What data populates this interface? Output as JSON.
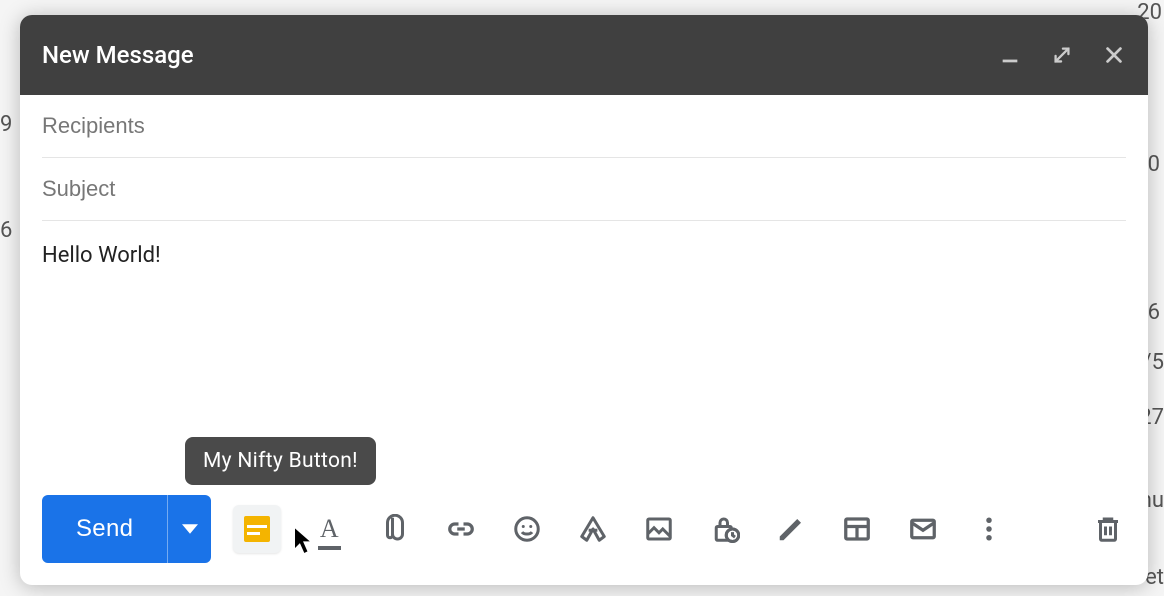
{
  "header": {
    "title": "New Message"
  },
  "fields": {
    "recipients_placeholder": "Recipients",
    "subject_placeholder": "Subject"
  },
  "body": {
    "text": "Hello World!"
  },
  "tooltip": {
    "text": "My Nifty Button!"
  },
  "toolbar": {
    "send_label": "Send"
  },
  "background_fragments": [
    "20",
    "9",
    "6",
    "0",
    "6",
    "/5",
    "27",
    "nu",
    "et"
  ],
  "icons": {
    "minimize": "minimize-icon",
    "fullscreen": "fullscreen-icon",
    "close": "close-icon",
    "custom": "nifty-button-icon",
    "format": "text-format-icon",
    "attach": "paperclip-icon",
    "link": "link-icon",
    "emoji": "smiley-icon",
    "drive": "drive-icon",
    "image": "image-icon",
    "confidential": "lock-clock-icon",
    "signature": "pen-icon",
    "layout": "layout-icon",
    "mail": "mail-icon",
    "more": "more-vert-icon",
    "discard": "trash-icon"
  }
}
